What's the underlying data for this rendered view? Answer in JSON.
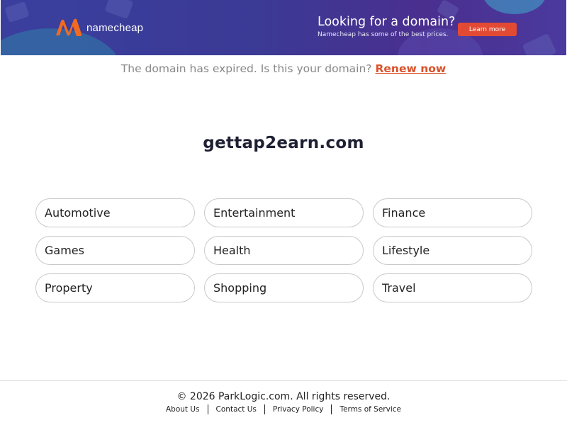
{
  "banner": {
    "brand": "namecheap",
    "promo_title": "Looking for a domain?",
    "promo_subtitle": "Namecheap has some of the best prices.",
    "cta_label": "Learn more",
    "colors": {
      "background": "#3b3a95",
      "cta": "#e34a33",
      "logo_orange": "#f26a21"
    }
  },
  "notice": {
    "text": "The domain has expired. Is this your domain?",
    "link_label": "Renew now",
    "link_color": "#d9532c"
  },
  "domain": "gettap2earn.com",
  "categories": [
    "Automotive",
    "Entertainment",
    "Finance",
    "Games",
    "Health",
    "Lifestyle",
    "Property",
    "Shopping",
    "Travel"
  ],
  "footer": {
    "copyright": "© 2026 ParkLogic.com. All rights reserved.",
    "links": [
      "About Us",
      "Contact Us",
      "Privacy Policy",
      "Terms of Service"
    ]
  }
}
